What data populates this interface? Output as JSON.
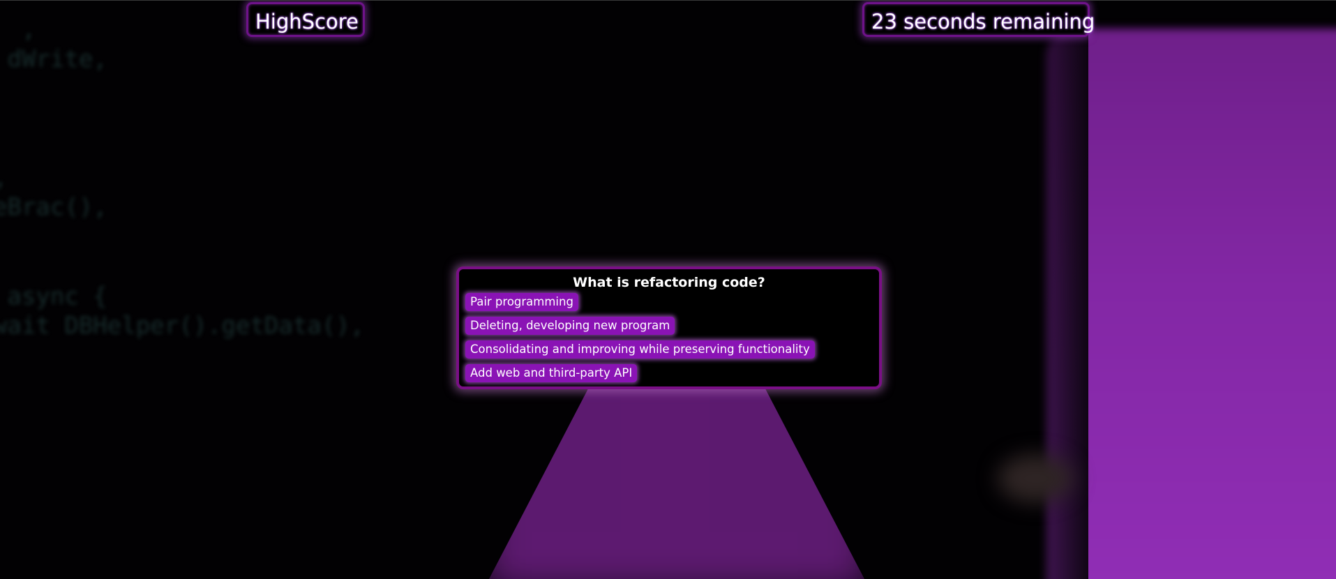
{
  "header": {
    "highscore_label": "HighScore",
    "timer_text": "23 seconds remaining"
  },
  "quiz": {
    "question": "What is refactoring code?",
    "answers": [
      "Pair programming",
      "Deleting, developing new program",
      "Consolidating and improving while preserving functionality",
      "Add web and third-party API"
    ]
  },
  "colors": {
    "accent_purple": "#8a13b5",
    "border_purple": "#7a0f86",
    "background": "#000000"
  }
}
